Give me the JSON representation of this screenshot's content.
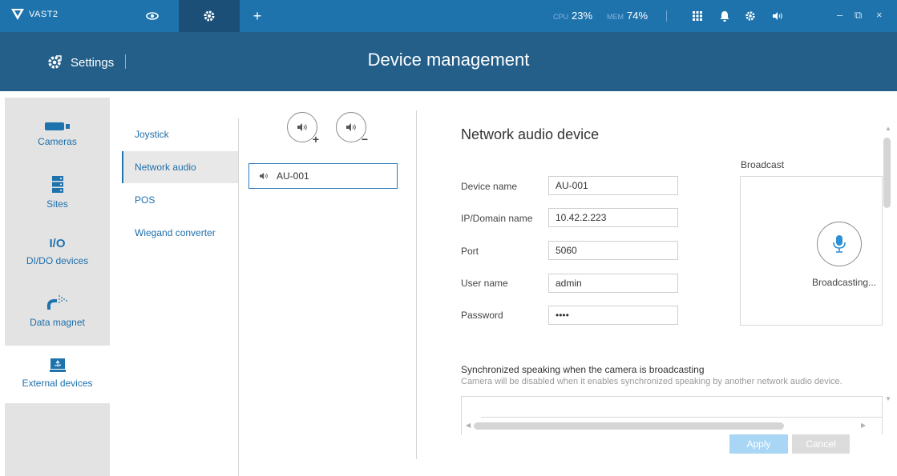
{
  "app": {
    "name": "VAST2"
  },
  "topbar": {
    "cpu_label": "CPU",
    "cpu_value": "23%",
    "mem_label": "MEM",
    "mem_value": "74%",
    "add_tab": "+",
    "win_minimize": "–",
    "win_restore": "⧉",
    "win_close": "×"
  },
  "header": {
    "section": "Settings",
    "title": "Device management"
  },
  "leftnav": {
    "items": [
      {
        "label": "Cameras",
        "icon": "camera-icon"
      },
      {
        "label": "Sites",
        "icon": "server-icon"
      },
      {
        "label": "DI/DO devices",
        "icon": "io-icon",
        "icon_text": "I/O"
      },
      {
        "label": "Data magnet",
        "icon": "magnet-icon"
      },
      {
        "label": "External devices",
        "icon": "external-device-icon",
        "active": true
      }
    ]
  },
  "subnav": {
    "items": [
      {
        "label": "Joystick"
      },
      {
        "label": "Network audio",
        "active": true
      },
      {
        "label": "POS"
      },
      {
        "label": "Wiegand converter"
      }
    ]
  },
  "device_list": {
    "add_badge": "+",
    "remove_badge": "−",
    "devices": [
      {
        "name": "AU-001"
      }
    ]
  },
  "form": {
    "title": "Network audio device",
    "device_name_label": "Device name",
    "device_name_value": "AU-001",
    "ip_label": "IP/Domain name",
    "ip_value": "10.42.2.223",
    "port_label": "Port",
    "port_value": "5060",
    "user_label": "User name",
    "user_value": "admin",
    "password_label": "Password",
    "password_value": "••••",
    "broadcast_label": "Broadcast",
    "broadcasting_text": "Broadcasting...",
    "sync_title": "Synchronized speaking when the camera is broadcasting",
    "sync_desc": "Camera will be disabled when it enables synchronized speaking by another network audio device.",
    "apply_label": "Apply",
    "cancel_label": "Cancel"
  },
  "colors": {
    "topbar": "#1e73ad",
    "header": "#245f8a",
    "active_tab": "#1c4f78",
    "accent": "#1e6fab",
    "apply_disabled": "#a9d6f5",
    "cancel_disabled": "#dcdcdc"
  }
}
